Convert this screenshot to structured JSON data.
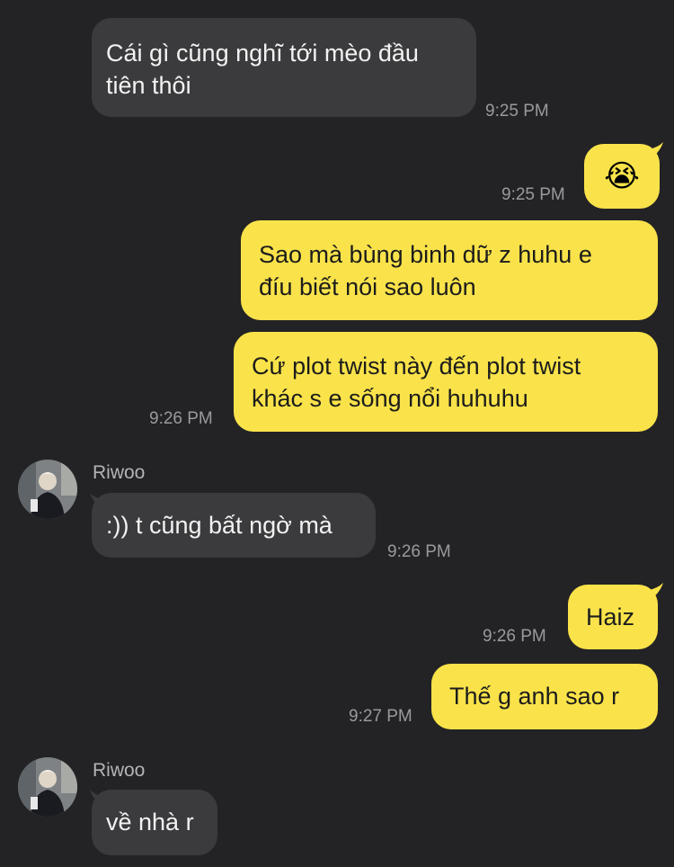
{
  "colors": {
    "background": "#232325",
    "incoming_bubble": "#3b3b3d",
    "outgoing_bubble": "#fae34a",
    "timestamp": "#9a9a9e"
  },
  "messages": [
    {
      "direction": "incoming",
      "text": "Cái gì cũng nghĩ tới mèo đầu\ntiên thôi",
      "time": "9:25 PM"
    },
    {
      "direction": "outgoing",
      "text": "😭",
      "time": "9:25 PM"
    },
    {
      "direction": "outgoing",
      "text": "Sao mà bùng binh dữ z huhu e\nđíu biết nói sao luôn",
      "time": ""
    },
    {
      "direction": "outgoing",
      "text": "Cứ plot twist này đến plot twist\nkhác s e sống nổi huhuhu",
      "time": "9:26 PM"
    },
    {
      "direction": "incoming",
      "sender": "Riwoo",
      "avatar": "user-avatar",
      "text": ":)) t cũng bất ngờ mà",
      "time": "9:26 PM"
    },
    {
      "direction": "outgoing",
      "text": "Haiz",
      "time": "9:26 PM"
    },
    {
      "direction": "outgoing",
      "text": "Thế g anh sao r",
      "time": "9:27 PM"
    },
    {
      "direction": "incoming",
      "sender": "Riwoo",
      "avatar": "user-avatar",
      "text": "về nhà r",
      "time": ""
    }
  ]
}
